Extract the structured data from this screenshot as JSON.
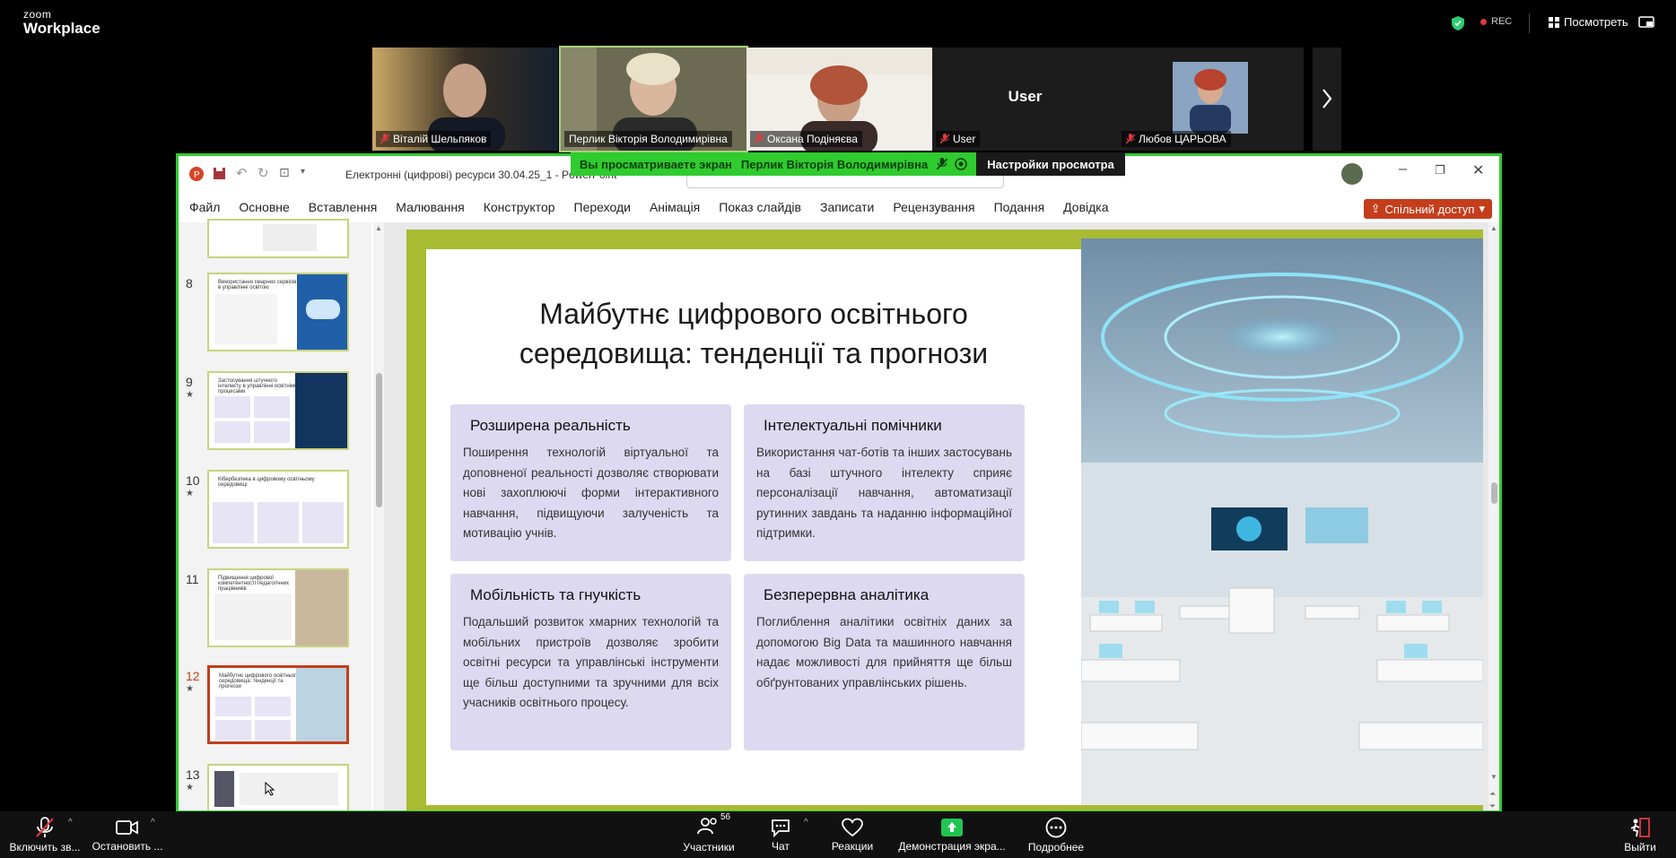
{
  "app": {
    "logo_top": "zoom",
    "logo_bottom": "Workplace",
    "rec_label": "REC",
    "view_label": "Посмотреть"
  },
  "participants": [
    {
      "name": "Віталій Шельпяков",
      "muted": true
    },
    {
      "name": "Перлик Вікторія Володимирівна",
      "muted": false
    },
    {
      "name": "Оксана Подіняєва",
      "muted": true
    },
    {
      "name": "User",
      "muted": true,
      "center_label": "User"
    },
    {
      "name": "Любов ЦАРЬОВА",
      "muted": true
    }
  ],
  "share_banner": {
    "viewing": "Вы просматриваете экран",
    "presenter": "Перлик Вікторія Володимирівна",
    "settings": "Настройки просмотра"
  },
  "ppt": {
    "file_title": "Електронні (цифрові) ресурси 30.04.25_1 - PowerPoint",
    "menu": [
      "Файл",
      "Основне",
      "Вставлення",
      "Малювання",
      "Конструктор",
      "Переходи",
      "Анімація",
      "Показ слайдів",
      "Записати",
      "Рецензування",
      "Подання",
      "Довідка"
    ],
    "share_button": "Спільний доступ",
    "thumbnails": [
      {
        "num": "8",
        "title": "Використання хмарних сервісів в управлінні освітою",
        "star": false
      },
      {
        "num": "9",
        "title": "Застосування штучного інтелекту в управлінні освітніми процесами",
        "star": true
      },
      {
        "num": "10",
        "title": "Кібербезпека в цифровому освітньому середовищі",
        "star": true
      },
      {
        "num": "11",
        "title": "Підвищення цифрової компетентності педагогічних працівників",
        "star": false
      },
      {
        "num": "12",
        "title": "Майбутнє цифрового освітнього середовища: тенденції та прогнози",
        "star": true
      },
      {
        "num": "13",
        "title": "",
        "star": true
      }
    ],
    "slide": {
      "title_line1": "Майбутнє цифрового освітнього",
      "title_line2": "середовища: тенденції та прогнози",
      "cards": [
        {
          "heading": "Розширена реальність",
          "text": "Поширення технологій віртуальної та доповненої реальності дозволяє створювати нові захоплюючі форми інтерактивного навчання, підвищуючи залученість та мотивацію учнів."
        },
        {
          "heading": "Інтелектуальні помічники",
          "text": "Використання чат-ботів та інших застосувань на базі штучного інтелекту сприяє персоналізації навчання, автоматизації рутинних завдань та наданню інформаційної підтримки."
        },
        {
          "heading": "Мобільність та гнучкість",
          "text": "Подальший розвиток хмарних технологій та мобільних пристроїв дозволяє зробити освітні ресурси та управлінські інструменти ще більш доступними та зручними для всіх учасників освітнього процесу."
        },
        {
          "heading": "Безперервна аналітика",
          "text": "Поглиблення аналітики освітніх даних за допомогою Big Data та машинного навчання надає можливості для прийняття ще більш обґрунтованих управлінських рішень."
        }
      ]
    }
  },
  "toolbar": {
    "audio": "Включить зв...",
    "video": "Остановить ...",
    "participants": "Участники",
    "participants_count": "56",
    "chat": "Чат",
    "reactions": "Реакции",
    "share": "Демонстрация экра...",
    "more": "Подробнее",
    "leave": "Выйти"
  },
  "colors": {
    "share_border": "#2fcb2f",
    "slide_accent": "#a8bb32",
    "card_bg": "#dcd9f0",
    "ppt_accent": "#c43e1c"
  }
}
